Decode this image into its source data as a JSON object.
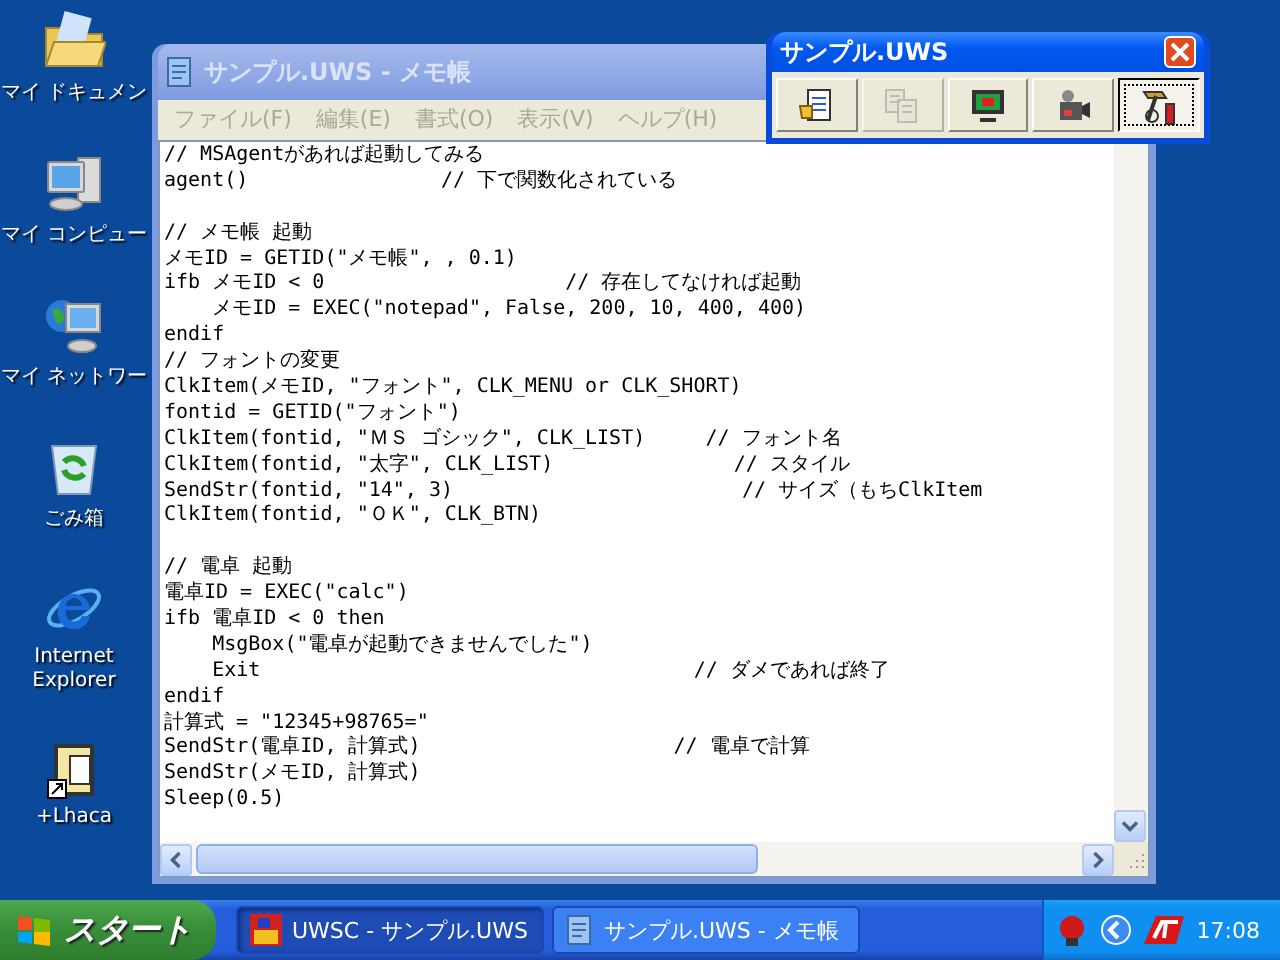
{
  "desktop_icons": [
    {
      "kind": "documents",
      "label": "マイ ドキュメン"
    },
    {
      "kind": "computer",
      "label": "マイ コンピュー"
    },
    {
      "kind": "network",
      "label": "マイ ネットワー"
    },
    {
      "kind": "recycle",
      "label": "ごみ箱"
    },
    {
      "kind": "browser",
      "label": "Internet Explorer"
    },
    {
      "kind": "archiver",
      "label": "+Lhaca"
    }
  ],
  "notepad": {
    "title": "サンプル.UWS - メモ帳",
    "active": false,
    "menu": [
      "ファイル(F)",
      "編集(E)",
      "書式(O)",
      "表示(V)",
      "ヘルプ(H)"
    ],
    "blocks": [
      [
        "// MSAgentがあれば起動してみる",
        "agent()                // 下で関数化されている"
      ],
      [
        "// メモ帳 起動",
        "メモID = GETID(\"メモ帳\", , 0.1)",
        "ifb メモID < 0                    // 存在してなければ起動",
        "    メモID = EXEC(\"notepad\", False, 200, 10, 400, 400)",
        "endif",
        "// フォントの変更",
        "ClkItem(メモID, \"フォント\", CLK_MENU or CLK_SHORT)",
        "fontid = GETID(\"フォント\")",
        "ClkItem(fontid, \"ＭＳ ゴシック\", CLK_LIST)     // フォント名",
        "ClkItem(fontid, \"太字\", CLK_LIST)               // スタイル",
        "SendStr(fontid, \"14\", 3)                        // サイズ（もちClkItem",
        "ClkItem(fontid, \"ＯＫ\", CLK_BTN)"
      ],
      [
        "// 電卓 起動",
        "電卓ID = EXEC(\"calc\")",
        "ifb 電卓ID < 0 then",
        "    MsgBox(\"電卓が起動できませんでした\")",
        "    Exit                                    // ダメであれば終了",
        "endif",
        "計算式 = \"12345+98765=\"",
        "SendStr(電卓ID, 計算式)                     // 電卓で計算",
        "SendStr(メモID, 計算式)",
        "Sleep(0.5)"
      ]
    ]
  },
  "toolbar": {
    "title": "サンプル.UWS",
    "active": true,
    "buttons": [
      {
        "kind": "document",
        "disabled": false,
        "selected": false
      },
      {
        "kind": "copy",
        "disabled": true,
        "selected": false
      },
      {
        "kind": "monitor",
        "disabled": false,
        "selected": false
      },
      {
        "kind": "camera",
        "disabled": false,
        "selected": false
      },
      {
        "kind": "tools",
        "disabled": false,
        "selected": true
      }
    ]
  },
  "taskbar": {
    "start": "スタート",
    "tasks": [
      {
        "kind": "uwsc",
        "label": "UWSC - サンプル.UWS",
        "selected": true
      },
      {
        "kind": "notepad",
        "label": "サンプル.UWS - メモ帳",
        "selected": false
      }
    ],
    "clock": "17:08"
  }
}
